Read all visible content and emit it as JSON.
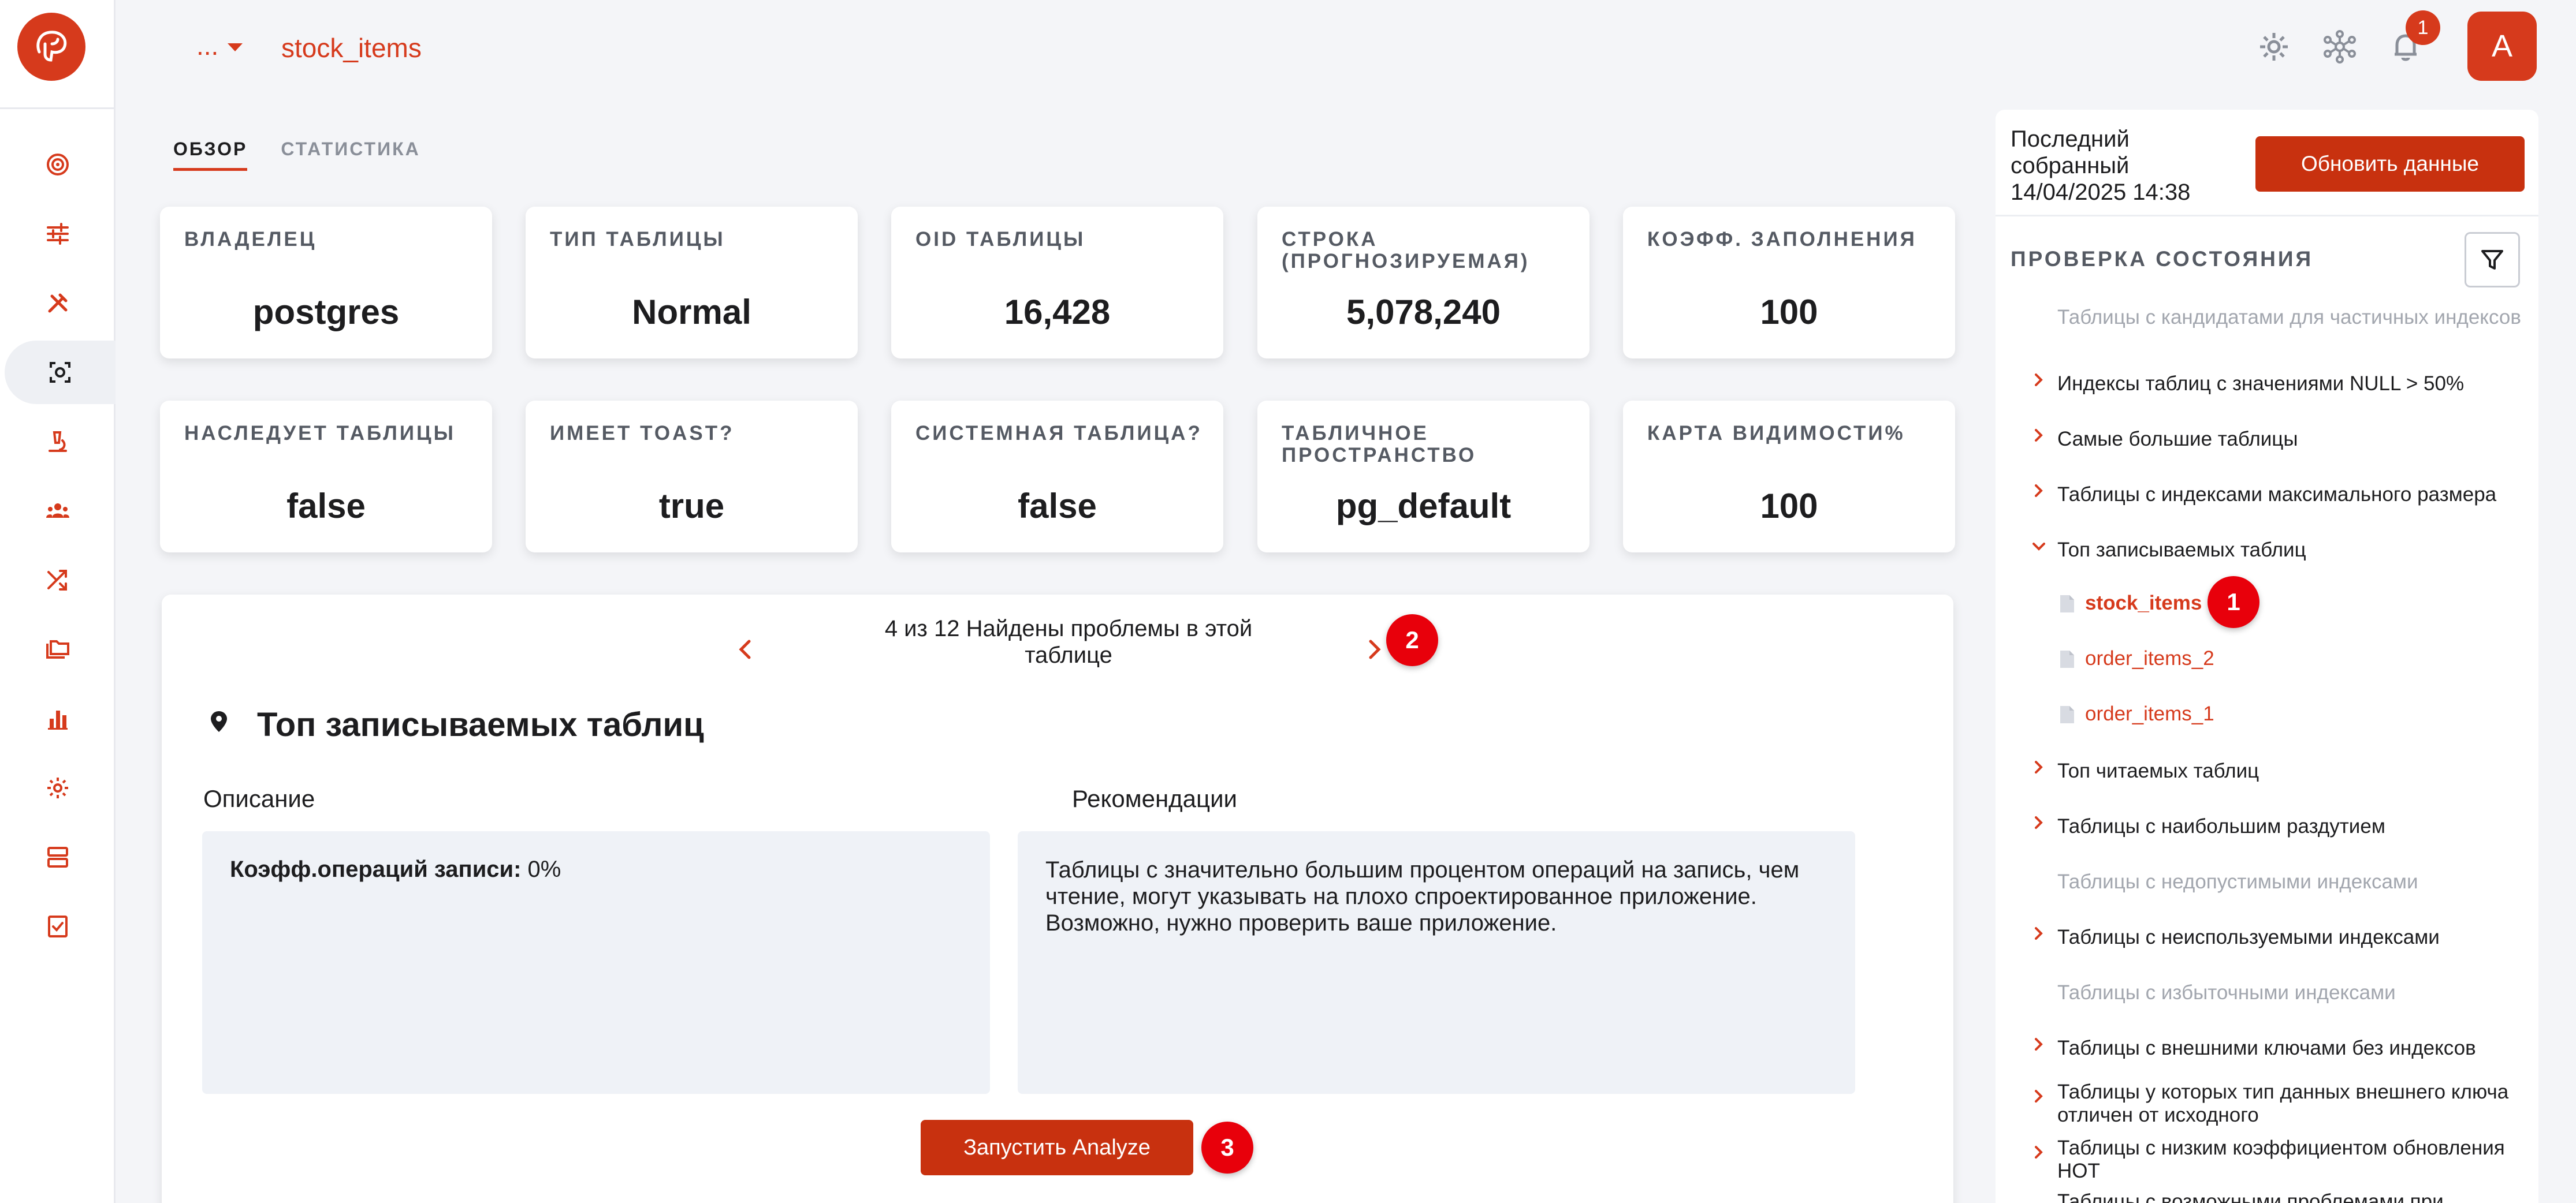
{
  "header": {
    "breadcrumb_more": "...",
    "title": "stock_items",
    "notification_count": "1",
    "avatar_initial": "A"
  },
  "tabs": [
    {
      "label": "ОБЗОР",
      "active": true
    },
    {
      "label": "СТАТИСТИКА",
      "active": false
    }
  ],
  "stats_row1": [
    {
      "label": "ВЛАДЕЛЕЦ",
      "value": "postgres"
    },
    {
      "label": "ТИП ТАБЛИЦЫ",
      "value": "Normal"
    },
    {
      "label": "OID ТАБЛИЦЫ",
      "value": "16,428"
    },
    {
      "label": "СТРОКА (ПРОГНОЗИРУЕМАЯ)",
      "value": "5,078,240"
    },
    {
      "label": "КОЭФФ. ЗАПОЛНЕНИЯ",
      "value": "100"
    }
  ],
  "stats_row2": [
    {
      "label": "НАСЛЕДУЕТ ТАБЛИЦЫ",
      "value": "false"
    },
    {
      "label": "ИМЕЕТ TOAST?",
      "value": "true"
    },
    {
      "label": "СИСТЕМНАЯ ТАБЛИЦА?",
      "value": "false"
    },
    {
      "label": "ТАБЛИЧНОЕ ПРОСТРАНСТВО",
      "value": "pg_default"
    },
    {
      "label": "КАРТА ВИДИМОСТИ%",
      "value": "100"
    }
  ],
  "problem": {
    "pager_text": "4 из 12 Найдены проблемы в этой таблице",
    "title": "Топ записываемых таблиц",
    "description_label": "Описание",
    "recommendations_label": "Рекомендации",
    "description_key": "Коэфф.операций записи:",
    "description_value": " 0%",
    "recommendation_text": "Таблицы с значительно большим процентом операций на запись, чем чтение, могут указывать на плохо спроектированное приложение. Возможно, нужно проверить ваше приложение.",
    "analyze_button": "Запустить Analyze"
  },
  "badges": {
    "b1": "1",
    "b2": "2",
    "b3": "3"
  },
  "right_panel": {
    "last_collected": "Последний собранный 14/04/2025 14:38",
    "refresh_button": "Обновить данные",
    "health_title": "ПРОВЕРКА СОСТОЯНИЯ",
    "items": [
      {
        "label": "Таблицы с кандидатами для частичных индексов",
        "state": "disabled"
      },
      {
        "label": "Индексы таблиц с значениями NULL > 50%",
        "state": "collapsed"
      },
      {
        "label": "Самые большие таблицы",
        "state": "collapsed"
      },
      {
        "label": "Таблицы с индексами максимального размера",
        "state": "collapsed"
      },
      {
        "label": "Топ записываемых таблиц",
        "state": "expanded"
      },
      {
        "label": "Топ читаемых таблиц",
        "state": "collapsed"
      },
      {
        "label": "Таблицы с наибольшим раздутием",
        "state": "collapsed"
      },
      {
        "label": "Таблицы с недопустимыми индексами",
        "state": "disabled"
      },
      {
        "label": "Таблицы с неиспользуемыми индексами",
        "state": "collapsed"
      },
      {
        "label": "Таблицы с избыточными индексами",
        "state": "disabled"
      },
      {
        "label": "Таблицы с внешними ключами без индексов",
        "state": "collapsed"
      },
      {
        "label": "Таблицы у которых тип данных внешнего ключа отличен от исходного",
        "state": "collapsed"
      },
      {
        "label": "Таблицы с низким коэффициентом обновления HOT",
        "state": "collapsed"
      },
      {
        "label": "Таблицы с возможными проблемами при",
        "state": "collapsed"
      }
    ],
    "leaves": [
      {
        "label": "stock_items",
        "active": true
      },
      {
        "label": "order_items_2",
        "active": false
      },
      {
        "label": "order_items_1",
        "active": false
      }
    ]
  },
  "colors": {
    "accent": "#d63a1c",
    "button": "#c8310f",
    "badge": "#e8000b"
  }
}
